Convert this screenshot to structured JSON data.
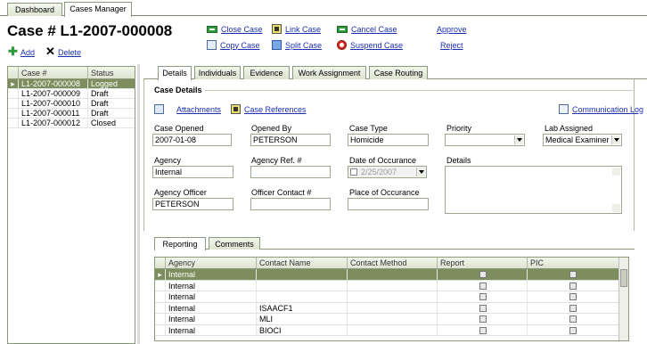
{
  "top_tabs": [
    {
      "label": "Dashboard",
      "active": false
    },
    {
      "label": "Cases Manager",
      "active": true
    }
  ],
  "case_title": "Case # L1-2007-000008",
  "actions": {
    "close_case": "Close Case",
    "link_case": "Link Case",
    "cancel_case": "Cancel Case",
    "approve": "Approve",
    "copy_case": "Copy Case",
    "split_case": "Split Case",
    "suspend_case": "Suspend Case",
    "reject": "Reject",
    "add": "Add",
    "delete": "Delete"
  },
  "case_list": {
    "headers": {
      "case": "Case #",
      "status": "Status"
    },
    "rows": [
      {
        "case": "L1-2007-000008",
        "status": "Logged",
        "selected": true
      },
      {
        "case": "L1-2007-000009",
        "status": "Draft",
        "selected": false
      },
      {
        "case": "L1-2007-000010",
        "status": "Draft",
        "selected": false
      },
      {
        "case": "L1-2007-000011",
        "status": "Draft",
        "selected": false
      },
      {
        "case": "L1-2007-000012",
        "status": "Closed",
        "selected": false
      }
    ]
  },
  "main_tabs": [
    {
      "label": "Details",
      "active": true
    },
    {
      "label": "Individuals",
      "active": false
    },
    {
      "label": "Evidence",
      "active": false
    },
    {
      "label": "Work Assignment",
      "active": false
    },
    {
      "label": "Case Routing",
      "active": false
    }
  ],
  "details": {
    "section_title": "Case Details",
    "attachments": "Attachments",
    "case_references": "Case References",
    "communication_log": "Communication Log",
    "fields": {
      "case_opened": {
        "label": "Case Opened",
        "value": "2007-01-08"
      },
      "opened_by": {
        "label": "Opened By",
        "value": "PETERSON"
      },
      "case_type": {
        "label": "Case Type",
        "value": "Homicide"
      },
      "priority": {
        "label": "Priority",
        "value": ""
      },
      "lab_assigned": {
        "label": "Lab Assigned",
        "value": "Medical Examiner"
      },
      "agency": {
        "label": "Agency",
        "value": "Internal"
      },
      "agency_ref": {
        "label": "Agency Ref. #",
        "value": ""
      },
      "date_of_occurance": {
        "label": "Date of Occurance",
        "value": "2/25/2007"
      },
      "details": {
        "label": "Details",
        "value": ""
      },
      "agency_officer": {
        "label": "Agency Officer",
        "value": "PETERSON"
      },
      "officer_contact": {
        "label": "Officer Contact #",
        "value": ""
      },
      "place_of_occurance": {
        "label": "Place of Occurance",
        "value": ""
      }
    }
  },
  "bottom_tabs": [
    {
      "label": "Reporting",
      "active": true
    },
    {
      "label": "Comments",
      "active": false
    }
  ],
  "reporting_grid": {
    "headers": {
      "agency": "Agency",
      "contact_name": "Contact Name",
      "contact_method": "Contact Method",
      "report": "Report",
      "pic": "PIC"
    },
    "rows": [
      {
        "agency": "Internal",
        "contact_name": "",
        "contact_method": "",
        "selected": true
      },
      {
        "agency": "Internal",
        "contact_name": "",
        "contact_method": "",
        "selected": false
      },
      {
        "agency": "Internal",
        "contact_name": "",
        "contact_method": "",
        "selected": false
      },
      {
        "agency": "Internal",
        "contact_name": "ISAACF1",
        "contact_method": "",
        "selected": false
      },
      {
        "agency": "Internal",
        "contact_name": "MLI",
        "contact_method": "",
        "selected": false
      },
      {
        "agency": "Internal",
        "contact_name": "BIOCI",
        "contact_method": "",
        "selected": false
      }
    ]
  },
  "colors": {
    "selection": "#7d8d5d",
    "link": "#1b2fb0",
    "tab_border": "#8a9a7a"
  }
}
